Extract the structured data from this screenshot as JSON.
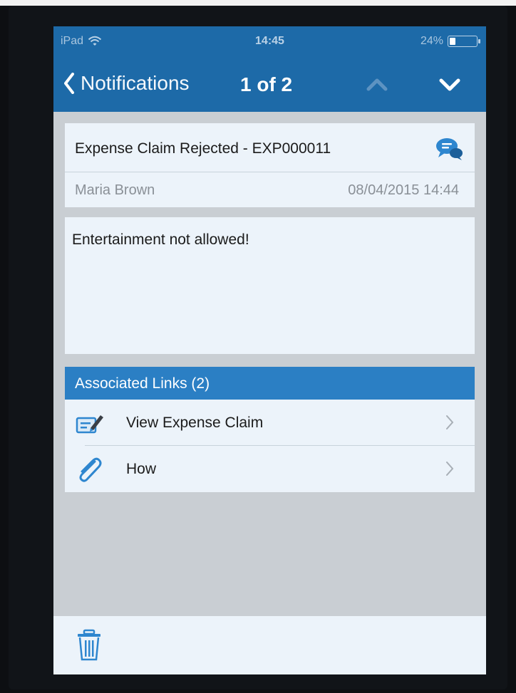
{
  "status_bar": {
    "device": "iPad",
    "time": "14:45",
    "battery_text": "24%",
    "battery_level": 0.24
  },
  "nav": {
    "back_label": "Notifications",
    "pager": "1 of 2",
    "back_icon": "chevron-left-icon",
    "prev_icon": "chevron-up-icon",
    "next_icon": "chevron-down-icon"
  },
  "notification": {
    "subject": "Expense Claim Rejected - EXP000011",
    "sender": "Maria Brown",
    "timestamp": "08/04/2015 14:44",
    "message": "Entertainment not allowed!",
    "comment_icon": "chat-bubbles-icon"
  },
  "associated_links": {
    "title": "Associated Links (2)",
    "items": [
      {
        "label": "View Expense Claim",
        "icon": "expense-form-icon"
      },
      {
        "label": "How",
        "icon": "paperclip-icon"
      }
    ]
  },
  "toolbar": {
    "delete_icon": "trash-icon"
  },
  "colors": {
    "nav_blue": "#1d6aa8",
    "section_blue": "#2b7fc4",
    "card_bg": "#ecf3fa",
    "page_bg": "#c9ced3"
  }
}
